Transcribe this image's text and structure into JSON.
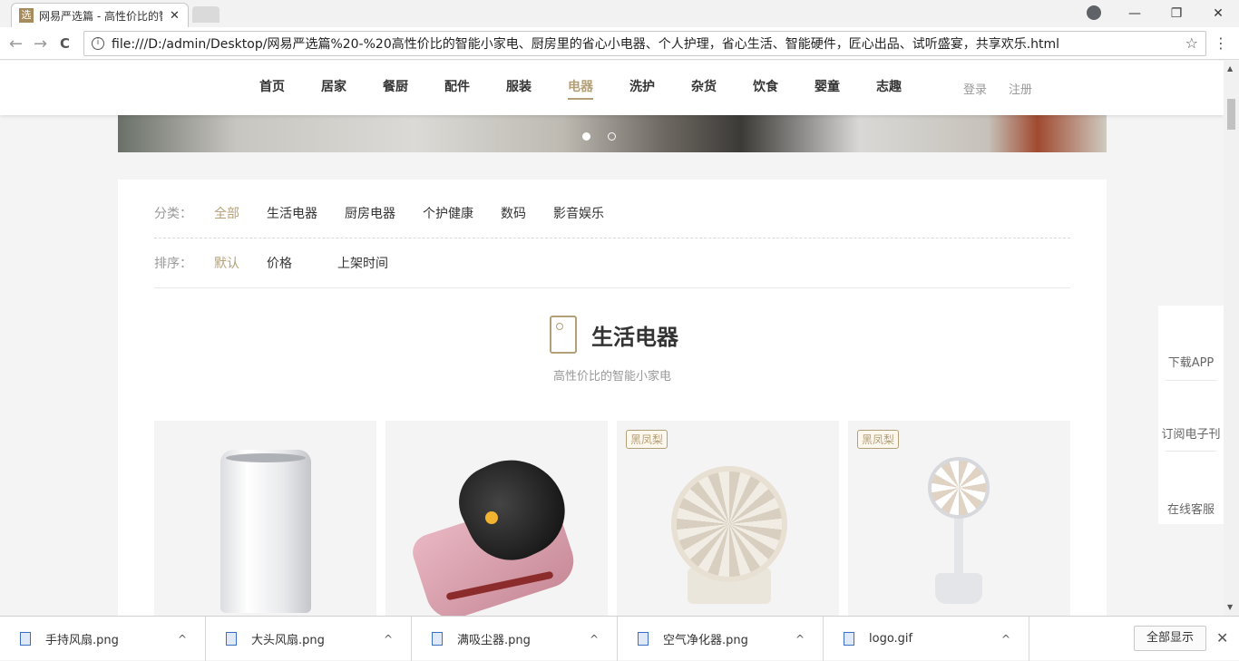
{
  "browser": {
    "tab_title": "网易严选篇 - 高性价比的智能小家电",
    "tab_favicon": "选",
    "tab_close": "✕",
    "address": "file:///D:/admin/Desktop/网易严选篇%20-%20高性价比的智能小家电、厨房里的省心小电器、个人护理，省心生活、智能硬件，匠心出品、试听盛宴，共享欢乐.html",
    "back": "←",
    "forward": "→",
    "reload": "C",
    "star": "☆",
    "menu": "⋮",
    "minimize": "—",
    "restore": "❐",
    "close": "✕"
  },
  "header": {
    "nav": [
      "首页",
      "居家",
      "餐厨",
      "配件",
      "服装",
      "电器",
      "洗护",
      "杂货",
      "饮食",
      "婴童",
      "志趣"
    ],
    "active_index": 5,
    "login": "登录",
    "register": "注册"
  },
  "filters": {
    "category_label": "分类：",
    "categories": [
      "全部",
      "生活电器",
      "厨房电器",
      "个护健康",
      "数码",
      "影音娱乐"
    ],
    "sort_label": "排序：",
    "sorts": [
      "默认",
      "价格",
      "上架时间"
    ]
  },
  "section": {
    "title": "生活电器",
    "subtitle": "高性价比的智能小家电"
  },
  "products": [
    {
      "tag": ""
    },
    {
      "tag": ""
    },
    {
      "tag": "黑凤梨"
    },
    {
      "tag": "黑凤梨"
    }
  ],
  "sidebar": {
    "app": "下载APP",
    "subscribe": "订阅电子刊",
    "service": "在线客服"
  },
  "downloads": {
    "files": [
      "手持风扇.png",
      "大头风扇.png",
      "满吸尘器.png",
      "空气净化器.png",
      "logo.gif"
    ],
    "caret": "^",
    "show_all": "全部显示",
    "close": "✕"
  }
}
